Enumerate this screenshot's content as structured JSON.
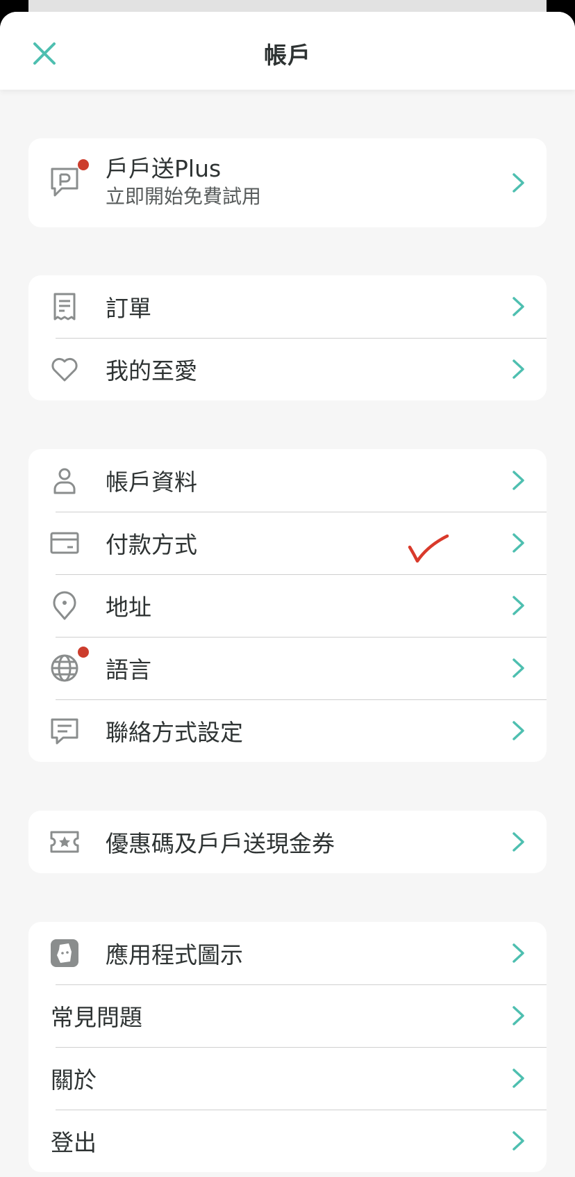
{
  "header": {
    "title": "帳戶",
    "close_icon": "close-icon",
    "accent_color": "#4ebfb0"
  },
  "plus_card": {
    "title": "戶戶送Plus",
    "subtitle": "立即開始免費試用",
    "icon": "plus-subscription-icon",
    "has_notification_badge": true
  },
  "orders_card": {
    "items": [
      {
        "label": "訂單",
        "icon": "receipt-icon"
      },
      {
        "label": "我的至愛",
        "icon": "heart-icon"
      }
    ]
  },
  "account_card": {
    "items": [
      {
        "label": "帳戶資料",
        "icon": "person-icon"
      },
      {
        "label": "付款方式",
        "icon": "credit-card-icon"
      },
      {
        "label": "地址",
        "icon": "location-pin-icon"
      },
      {
        "label": "語言",
        "icon": "globe-icon",
        "has_notification_badge": true
      },
      {
        "label": "聯絡方式設定",
        "icon": "chat-bubble-icon"
      }
    ]
  },
  "vouchers_card": {
    "items": [
      {
        "label": "優惠碼及戶戶送現金券",
        "icon": "voucher-ticket-icon"
      }
    ]
  },
  "misc_card": {
    "items": [
      {
        "label": "應用程式圖示",
        "icon": "app-logo-icon"
      },
      {
        "label": "常見問題"
      },
      {
        "label": "關於"
      },
      {
        "label": "登出"
      }
    ]
  },
  "annotation": {
    "icon": "red-checkmark-icon",
    "color": "#d93a2b"
  },
  "colors": {
    "badge": "#cc3d2d",
    "chevron": "#4ebfb0",
    "icon_gray": "#8a8d8d",
    "background": "#f6f6f6"
  }
}
